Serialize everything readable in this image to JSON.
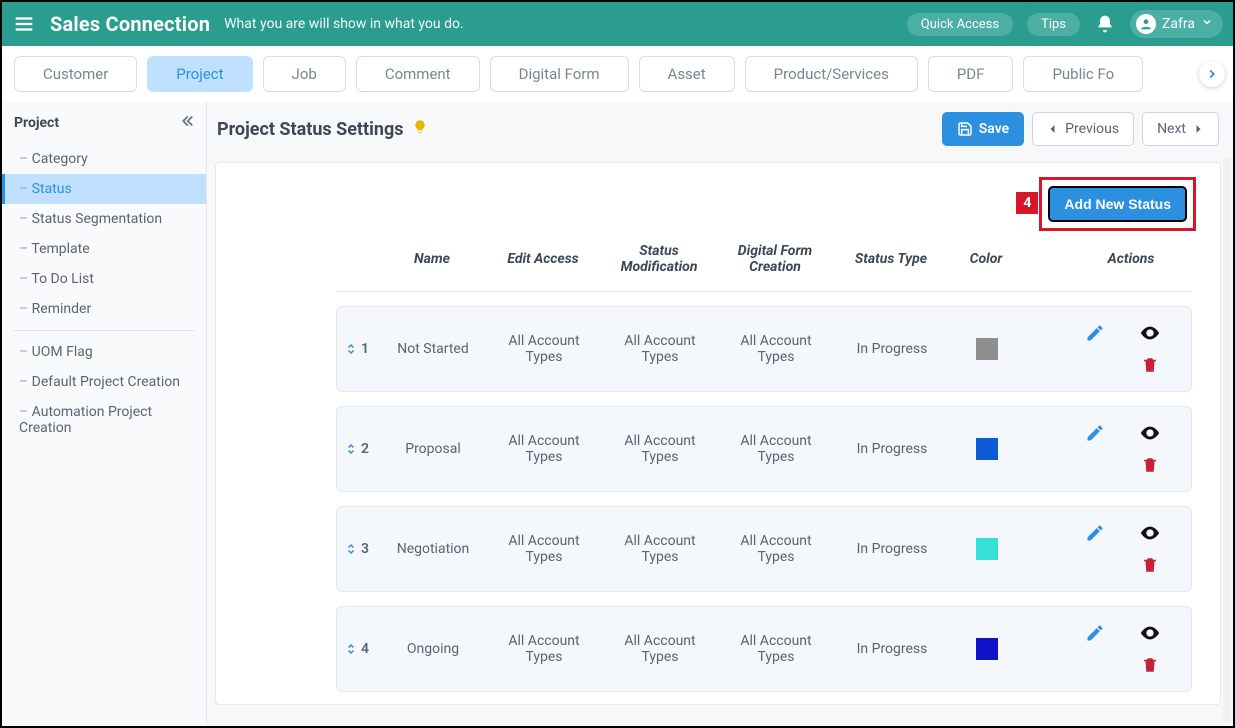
{
  "header": {
    "brand": "Sales Connection",
    "tagline": "What you are will show in what you do.",
    "quick_access": "Quick Access",
    "tips": "Tips",
    "user_name": "Zafra"
  },
  "tabs": [
    {
      "label": "Customer",
      "active": false
    },
    {
      "label": "Project",
      "active": true
    },
    {
      "label": "Job",
      "active": false
    },
    {
      "label": "Comment",
      "active": false
    },
    {
      "label": "Digital Form",
      "active": false
    },
    {
      "label": "Asset",
      "active": false
    },
    {
      "label": "Product/Services",
      "active": false
    },
    {
      "label": "PDF",
      "active": false
    },
    {
      "label": "Public Fo",
      "active": false
    }
  ],
  "sidebar": {
    "title": "Project",
    "items": [
      {
        "label": "Category",
        "active": false
      },
      {
        "label": "Status",
        "active": true
      },
      {
        "label": "Status Segmentation",
        "active": false
      },
      {
        "label": "Template",
        "active": false
      },
      {
        "label": "To Do List",
        "active": false
      },
      {
        "label": "Reminder",
        "active": false
      }
    ],
    "items2": [
      {
        "label": "UOM Flag"
      },
      {
        "label": "Default Project Creation"
      },
      {
        "label": "Automation Project Creation"
      }
    ]
  },
  "page": {
    "title": "Project Status Settings",
    "save": "Save",
    "previous": "Previous",
    "next": "Next",
    "add_new_status": "Add New Status",
    "callout_number": "4"
  },
  "columns": {
    "index": "",
    "name": "Name",
    "edit_access": "Edit Access",
    "status_modification": "Status Modification",
    "digital_form_creation": "Digital Form Creation",
    "status_type": "Status Type",
    "color": "Color",
    "actions": "Actions"
  },
  "rows": [
    {
      "index": "1",
      "name": "Not Started",
      "edit_access": "All Account Types",
      "status_modification": "All Account Types",
      "digital_form_creation": "All Account Types",
      "status_type": "In Progress",
      "color": "#8f8f8f"
    },
    {
      "index": "2",
      "name": "Proposal",
      "edit_access": "All Account Types",
      "status_modification": "All Account Types",
      "digital_form_creation": "All Account Types",
      "status_type": "In Progress",
      "color": "#0b5bd6"
    },
    {
      "index": "3",
      "name": "Negotiation",
      "edit_access": "All Account Types",
      "status_modification": "All Account Types",
      "digital_form_creation": "All Account Types",
      "status_type": "In Progress",
      "color": "#35e0d6"
    },
    {
      "index": "4",
      "name": "Ongoing",
      "edit_access": "All Account Types",
      "status_modification": "All Account Types",
      "digital_form_creation": "All Account Types",
      "status_type": "In Progress",
      "color": "#1212c8"
    }
  ]
}
